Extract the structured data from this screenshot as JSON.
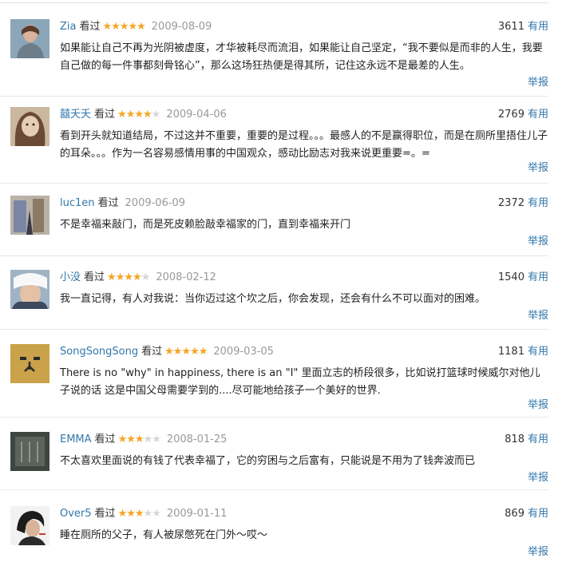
{
  "labels": {
    "watched": "看过",
    "useful": "有用",
    "report": "举报"
  },
  "colors": {
    "link": "#3377aa",
    "star_on": "#f5a623",
    "star_off": "#d6d6d6",
    "date": "#999999"
  },
  "comments": [
    {
      "author": "Zia",
      "rating": 5,
      "date": "2009-08-09",
      "votes": "3611",
      "text": "如果能让自己不再为光阴被虚度，才华被耗尽而流泪，如果能让自己坚定，“我不要似是而非的人生，我要自己做的每一件事都刻骨铭心”，那么这场狂热便是得其所，记住这永远不是最差的人生。"
    },
    {
      "author": "囍夭夭",
      "rating": 4,
      "date": "2009-04-06",
      "votes": "2769",
      "text": "看到开头就知道结局，不过这并不重要，重要的是过程。。。最感人的不是赢得职位，而是在厕所里捂住儿子的耳朵。。。作为一名容易感情用事的中国观众，感动比励志对我来说更重要=。="
    },
    {
      "author": "luc1en",
      "rating": 0,
      "date": "2009-06-09",
      "votes": "2372",
      "text": "不是幸福来敲门，而是死皮赖脸敲幸福家的门，直到幸福来开门"
    },
    {
      "author": "小没",
      "rating": 4,
      "date": "2008-02-12",
      "votes": "1540",
      "text": "我一直记得，有人对我说：当你迈过这个坎之后，你会发现，还会有什么不可以面对的困难。"
    },
    {
      "author": "SongSongSong",
      "rating": 5,
      "date": "2009-03-05",
      "votes": "1181",
      "text": "There is no \"why\"    in happiness, there is an \"I\" 里面立志的桥段很多，比如说打篮球时候威尔对他儿子说的话 这是中国父母需要学到的....尽可能地给孩子一个美好的世界."
    },
    {
      "author": "EMMA",
      "rating": 3,
      "date": "2008-01-25",
      "votes": "818",
      "text": "不太喜欢里面说的有钱了代表幸福了，它的穷困与之后富有，只能说是不用为了钱奔波而已"
    },
    {
      "author": "Over5",
      "rating": 3,
      "date": "2009-01-11",
      "votes": "869",
      "text": "睡在厕所的父子，有人被尿憋死在门外～哎～"
    }
  ]
}
